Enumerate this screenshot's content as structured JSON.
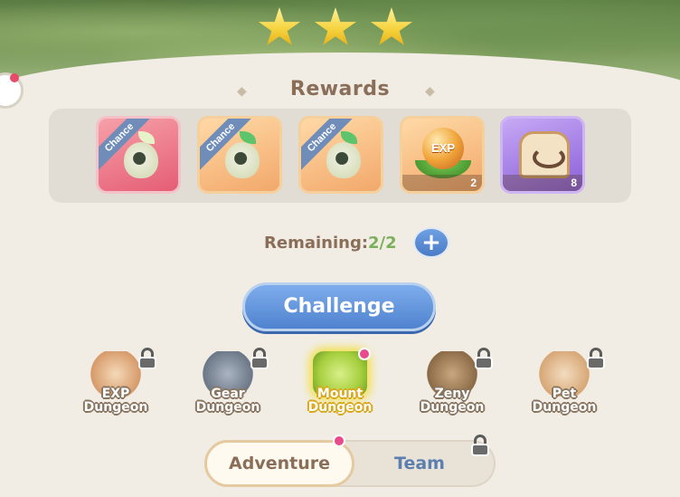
{
  "stars": {
    "earned": 3,
    "total": 3
  },
  "rewards": {
    "title": "Rewards",
    "items": [
      {
        "icon": "mount-seed-red-icon",
        "tag": "Chance",
        "count": "",
        "frame": "pink"
      },
      {
        "icon": "mount-seed-orange-icon",
        "tag": "Chance",
        "count": "",
        "frame": "orange"
      },
      {
        "icon": "mount-seed-orange-icon",
        "tag": "Chance",
        "count": "",
        "frame": "orange"
      },
      {
        "icon": "exp-orb-icon",
        "tag": "",
        "label": "EXP",
        "count": "2",
        "frame": "orange"
      },
      {
        "icon": "toast-food-icon",
        "tag": "",
        "count": "8",
        "frame": "purple"
      }
    ]
  },
  "remaining": {
    "label": "Remaining:",
    "value": "2/2"
  },
  "challenge": {
    "label": "Challenge"
  },
  "dungeons": [
    {
      "line1": "EXP",
      "line2": "Dungeon",
      "locked": true,
      "active": false
    },
    {
      "line1": "Gear",
      "line2": "Dungeon",
      "locked": true,
      "active": false
    },
    {
      "line1": "Mount",
      "line2": "Dungeon",
      "locked": false,
      "active": true
    },
    {
      "line1": "Zeny",
      "line2": "Dungeon",
      "locked": true,
      "active": false
    },
    {
      "line1": "Pet",
      "line2": "Dungeon",
      "locked": true,
      "active": false
    }
  ],
  "tabs": {
    "adventure": "Adventure",
    "team": "Team"
  },
  "colors": {
    "accent_blue": "#4f83cf",
    "remaining_value": "#7bb05a",
    "text_brown": "#8a6e58"
  }
}
